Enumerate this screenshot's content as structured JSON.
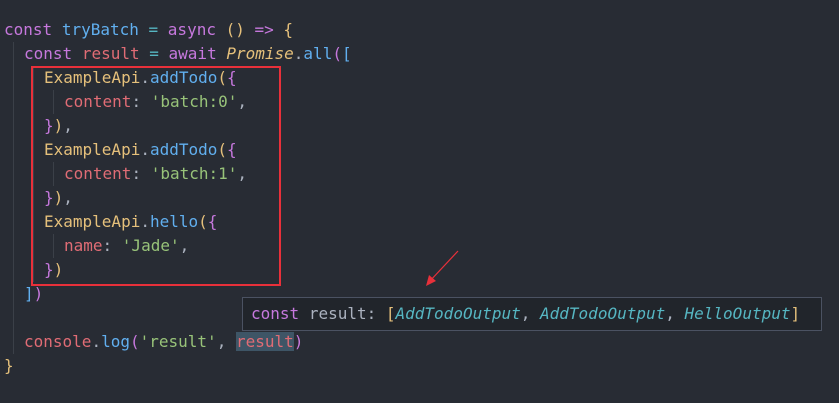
{
  "code": {
    "kw_const": "const",
    "kw_async": "async",
    "kw_await": "await",
    "fn_trybatch": "tryBatch",
    "var_result": "result",
    "cls_promise": "Promise",
    "fn_all": "all",
    "cls_exampleapi": "ExampleApi",
    "fn_addtodo": "addTodo",
    "fn_hello": "hello",
    "prop_content": "content",
    "prop_name": "name",
    "str_batch0": "'batch:0'",
    "str_batch1": "'batch:1'",
    "str_jade": "'Jade'",
    "str_result": "'result'",
    "obj_console": "console",
    "fn_log": "log"
  },
  "tooltip": {
    "keyword": "const",
    "name": "result",
    "types": [
      "AddTodoOutput",
      "AddTodoOutput",
      "HelloOutput"
    ]
  },
  "colors": {
    "background": "#282c34",
    "annotation": "#e8303a"
  }
}
